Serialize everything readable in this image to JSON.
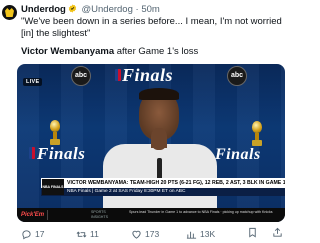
{
  "author": {
    "name": "Underdog",
    "handle": "@Underdog",
    "separator": "·",
    "time": "50m",
    "verified_color": "#f2c51b"
  },
  "tweet": {
    "text": "\"We've been down in a series before... I mean, I'm not worried [in] the slightest\"",
    "caption_bold": "Victor Wembanyama",
    "caption_rest": " after Game 1's loss"
  },
  "media": {
    "live_label": "LIVE",
    "network_logo": "abc",
    "finals_word": "Finals",
    "lower_third_line1": "VICTOR WEMBANYAMA: TEAM-HIGH 20 PTS (6-21 FG), 12 REB, 2 AST, 3 BLK IN GAME 1 LOSS",
    "lower_third_line2": "NBA Finals | Game 2 at SAS Friday 8:30PM ET on ABC",
    "lower_third_logo": "NBA FINALS",
    "ticker_brand": "Pick'Em",
    "ticker_source": "SPORTS INSIGHTS",
    "ticker_text": "Spurs lead Thunder in Game 1 to advance to NBA Finals · picking up matchup with Knicks"
  },
  "actions": {
    "replies": "17",
    "retweets": "11",
    "likes": "173",
    "views": "13K"
  },
  "colors": {
    "text_primary": "#0f1419",
    "text_secondary": "#536471",
    "media_bg": "#0c3a78"
  }
}
